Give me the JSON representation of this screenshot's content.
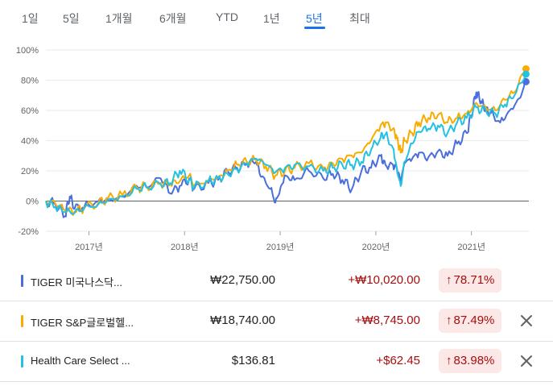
{
  "range_tabs": [
    {
      "label": "1일",
      "active": false
    },
    {
      "label": "5일",
      "active": false
    },
    {
      "label": "1개월",
      "active": false
    },
    {
      "label": "6개월",
      "active": false
    },
    {
      "label": "YTD",
      "active": false
    },
    {
      "label": "1년",
      "active": false
    },
    {
      "label": "5년",
      "active": true
    },
    {
      "label": "최대",
      "active": false
    }
  ],
  "chart_data": {
    "type": "line",
    "y_tick_labels": [
      "100%",
      "80%",
      "60%",
      "40%",
      "20%",
      "0%",
      "-20%"
    ],
    "y_ticks": [
      100,
      80,
      60,
      40,
      20,
      0,
      -20
    ],
    "ylim": [
      -20,
      100
    ],
    "x_tick_labels": [
      "2017년",
      "2018년",
      "2019년",
      "2020년",
      "2021년"
    ],
    "x_ticks": [
      2017.0,
      2018.0,
      2019.0,
      2020.0,
      2021.0
    ],
    "xlim": [
      2016.55,
      2021.6
    ],
    "grid": "horizontal",
    "baseline": 0,
    "series": [
      {
        "color": "#4a6fdc",
        "x": [
          2016.55,
          2016.65,
          2016.75,
          2016.8,
          2016.85,
          2016.95,
          2017.1,
          2017.2,
          2017.35,
          2017.5,
          2017.6,
          2017.75,
          2017.85,
          2017.95,
          2018.05,
          2018.1,
          2018.25,
          2018.35,
          2018.45,
          2018.55,
          2018.65,
          2018.75,
          2018.8,
          2018.9,
          2018.95,
          2019.0,
          2019.05,
          2019.15,
          2019.3,
          2019.45,
          2019.55,
          2019.65,
          2019.75,
          2019.85,
          2019.95,
          2020.05,
          2020.1,
          2020.18,
          2020.22,
          2020.26,
          2020.3,
          2020.38,
          2020.45,
          2020.55,
          2020.65,
          2020.75,
          2020.85,
          2020.95,
          2021.0,
          2021.05,
          2021.1,
          2021.15,
          2021.2,
          2021.3,
          2021.4,
          2021.5,
          2021.57
        ],
        "y": [
          0,
          -2,
          -10,
          3,
          -5,
          -4,
          0,
          1,
          3,
          10,
          9,
          15,
          5,
          10,
          15,
          8,
          12,
          14,
          20,
          22,
          25,
          26,
          16,
          8,
          -1,
          8,
          17,
          14,
          20,
          15,
          18,
          14,
          8,
          20,
          22,
          30,
          24,
          24,
          22,
          13,
          25,
          28,
          32,
          29,
          33,
          30,
          38,
          45,
          57,
          72,
          66,
          60,
          58,
          52,
          60,
          68,
          79
        ]
      },
      {
        "color": "#f9ab00",
        "x": [
          2016.55,
          2016.65,
          2016.75,
          2016.85,
          2016.95,
          2017.1,
          2017.2,
          2017.35,
          2017.5,
          2017.6,
          2017.75,
          2017.85,
          2017.95,
          2018.05,
          2018.1,
          2018.25,
          2018.35,
          2018.45,
          2018.55,
          2018.65,
          2018.75,
          2018.85,
          2018.95,
          2019.05,
          2019.15,
          2019.3,
          2019.45,
          2019.55,
          2019.65,
          2019.75,
          2019.85,
          2019.95,
          2020.05,
          2020.1,
          2020.18,
          2020.22,
          2020.26,
          2020.3,
          2020.38,
          2020.45,
          2020.55,
          2020.65,
          2020.75,
          2020.85,
          2020.95,
          2021.05,
          2021.15,
          2021.25,
          2021.35,
          2021.45,
          2021.57
        ],
        "y": [
          0,
          -2,
          -6,
          -7,
          -4,
          -1,
          2,
          4,
          9,
          10,
          12,
          11,
          13,
          17,
          10,
          14,
          16,
          20,
          24,
          26,
          27,
          23,
          17,
          20,
          22,
          25,
          22,
          25,
          28,
          30,
          32,
          40,
          50,
          52,
          48,
          42,
          32,
          40,
          45,
          52,
          55,
          57,
          52,
          55,
          58,
          65,
          62,
          60,
          67,
          72,
          87.5
        ]
      },
      {
        "color": "#24c1e0",
        "x": [
          2016.55,
          2016.65,
          2016.75,
          2016.85,
          2016.95,
          2017.1,
          2017.2,
          2017.35,
          2017.5,
          2017.6,
          2017.75,
          2017.85,
          2017.95,
          2018.05,
          2018.1,
          2018.25,
          2018.35,
          2018.45,
          2018.55,
          2018.65,
          2018.75,
          2018.85,
          2018.95,
          2019.05,
          2019.15,
          2019.3,
          2019.45,
          2019.55,
          2019.65,
          2019.75,
          2019.85,
          2019.95,
          2020.05,
          2020.1,
          2020.18,
          2020.22,
          2020.26,
          2020.3,
          2020.38,
          2020.45,
          2020.55,
          2020.65,
          2020.75,
          2020.85,
          2020.95,
          2021.05,
          2021.15,
          2021.25,
          2021.35,
          2021.45,
          2021.57
        ],
        "y": [
          0,
          -4,
          -7,
          -8,
          -5,
          -2,
          1,
          3,
          8,
          9,
          11,
          12,
          20,
          14,
          9,
          13,
          15,
          18,
          21,
          25,
          28,
          24,
          19,
          22,
          24,
          23,
          20,
          22,
          24,
          24,
          26,
          34,
          42,
          44,
          35,
          22,
          10,
          26,
          38,
          46,
          48,
          50,
          45,
          52,
          55,
          62,
          60,
          58,
          64,
          70,
          84
        ]
      }
    ]
  },
  "holdings": [
    {
      "name": "TIGER 미국나스닥...",
      "color": "#4a6fdc",
      "price": "₩22,750.00",
      "change": "+₩10,020.00",
      "pct": "78.71%",
      "arrow": "↑",
      "removable": false
    },
    {
      "name": "TIGER S&P글로벌헬...",
      "color": "#f9ab00",
      "price": "₩18,740.00",
      "change": "+₩8,745.00",
      "pct": "87.49%",
      "arrow": "↑",
      "removable": true
    },
    {
      "name": "Health Care Select ...",
      "color": "#24c1e0",
      "price": "$136.81",
      "change": "+$62.45",
      "pct": "83.98%",
      "arrow": "↑",
      "removable": true
    }
  ],
  "colors": {
    "accent": "#1a73e8",
    "gain_text": "#a50e0e",
    "gain_bg": "#fce8e6"
  },
  "icons": {
    "remove": "close-icon",
    "up": "arrow-up-icon"
  }
}
